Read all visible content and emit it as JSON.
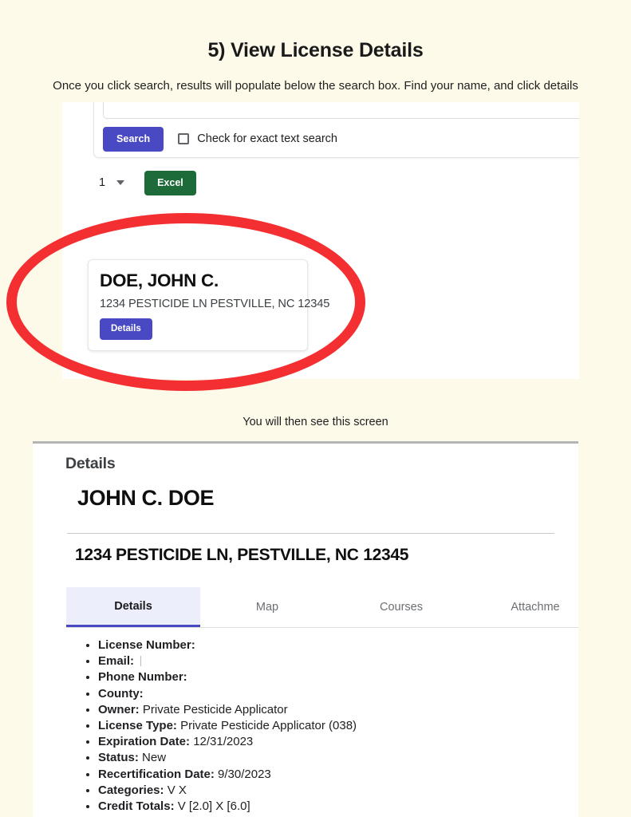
{
  "slide": {
    "title": "5) View License Details",
    "subtitle": "Once you click search, results will populate below the search box. Find your name, and click details",
    "mid_caption": "You will then see this screen",
    "background_color": "#fdfaea",
    "highlight_color": "#f42f32"
  },
  "search_screen": {
    "search_input_value": "",
    "search_input_placeholder": "",
    "search_button_label": "Search",
    "exact_text_label": "Check for exact text search",
    "exact_text_checked": false,
    "page_number": "1",
    "excel_button_label": "Excel",
    "accent_color": "#4a49c4",
    "excel_color": "#1e6b3a",
    "result": {
      "name": "DOE, JOHN C.",
      "address": "1234 PESTICIDE LN PESTVILLE, NC 12345",
      "details_button_label": "Details"
    }
  },
  "details_screen": {
    "kicker": "Details",
    "person_name": "JOHN C. DOE",
    "person_address": "1234 PESTICIDE LN, PESTVILLE, NC 12345",
    "tabs": [
      {
        "label": "Details",
        "active": true
      },
      {
        "label": "Map",
        "active": false
      },
      {
        "label": "Courses",
        "active": false
      },
      {
        "label": "Attachme",
        "active": false
      }
    ],
    "fields": [
      {
        "label": "License Number:",
        "value": ""
      },
      {
        "label": "Email:",
        "value": ""
      },
      {
        "label": "Phone Number:",
        "value": ""
      },
      {
        "label": "County:",
        "value": ""
      },
      {
        "label": "Owner:",
        "value": "Private Pesticide Applicator"
      },
      {
        "label": "License Type:",
        "value": "Private Pesticide Applicator (038)"
      },
      {
        "label": "Expiration Date:",
        "value": "12/31/2023"
      },
      {
        "label": "Status:",
        "value": "New"
      },
      {
        "label": "Recertification Date:",
        "value": "9/30/2023"
      },
      {
        "label": "Categories:",
        "value": "V X"
      },
      {
        "label": "Credit Totals:",
        "value": "V [2.0] X [6.0]"
      }
    ]
  }
}
